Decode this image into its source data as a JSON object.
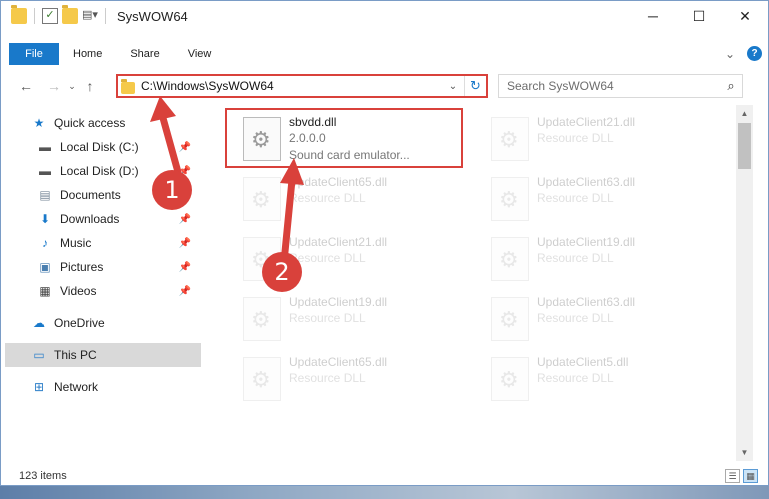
{
  "title_bar": {
    "title": "SysWOW64",
    "minimize": "─",
    "maximize": "☐",
    "close": "✕"
  },
  "ribbon": {
    "tabs": [
      "File",
      "Home",
      "Share",
      "View"
    ],
    "expand": "⌄",
    "help": "?"
  },
  "address": {
    "path": "C:\\Windows\\SysWOW64",
    "search_placeholder": "Search SysWOW64"
  },
  "nav_pane": {
    "items": [
      {
        "label": "Quick access",
        "icon": "star-icon"
      },
      {
        "label": "Local Disk (C:)",
        "icon": "drive-icon",
        "pinned": true
      },
      {
        "label": "Local Disk (D:)",
        "icon": "drive-icon",
        "pinned": true
      },
      {
        "label": "Documents",
        "icon": "documents-icon",
        "pinned": true
      },
      {
        "label": "Downloads",
        "icon": "download-icon",
        "pinned": true
      },
      {
        "label": "Music",
        "icon": "music-icon",
        "pinned": true
      },
      {
        "label": "Pictures",
        "icon": "pictures-icon",
        "pinned": true
      },
      {
        "label": "Videos",
        "icon": "videos-icon",
        "pinned": true
      },
      {
        "label": "OneDrive",
        "icon": "cloud-icon"
      },
      {
        "label": "This PC",
        "icon": "pc-icon",
        "selected": true
      },
      {
        "label": "Network",
        "icon": "network-icon"
      }
    ]
  },
  "files": [
    {
      "name": "sbvdd.dll",
      "line2": "2.0.0.0",
      "line3": "Sound card emulator...",
      "highlighted": true
    },
    {
      "name": "UpdateClient21.dll",
      "line2": "Resource DLL"
    },
    {
      "name": "UpdateClient65.dll",
      "line2": "Resource DLL"
    },
    {
      "name": "UpdateClient63.dll",
      "line2": "Resource DLL"
    },
    {
      "name": "UpdateClient21.dll",
      "line2": "Resource DLL"
    },
    {
      "name": "UpdateClient19.dll",
      "line2": "Resource DLL"
    },
    {
      "name": "UpdateClient19.dll",
      "line2": "Resource DLL"
    },
    {
      "name": "UpdateClient63.dll",
      "line2": "Resource DLL"
    },
    {
      "name": "UpdateClient65.dll",
      "line2": "Resource DLL"
    },
    {
      "name": "UpdateClient5.dll",
      "line2": "Resource DLL"
    }
  ],
  "status": {
    "item_count": "123 items"
  },
  "annotations": {
    "step1": "1",
    "step2": "2"
  },
  "colors": {
    "accent": "#1979ca",
    "annotation": "#d9413b"
  }
}
